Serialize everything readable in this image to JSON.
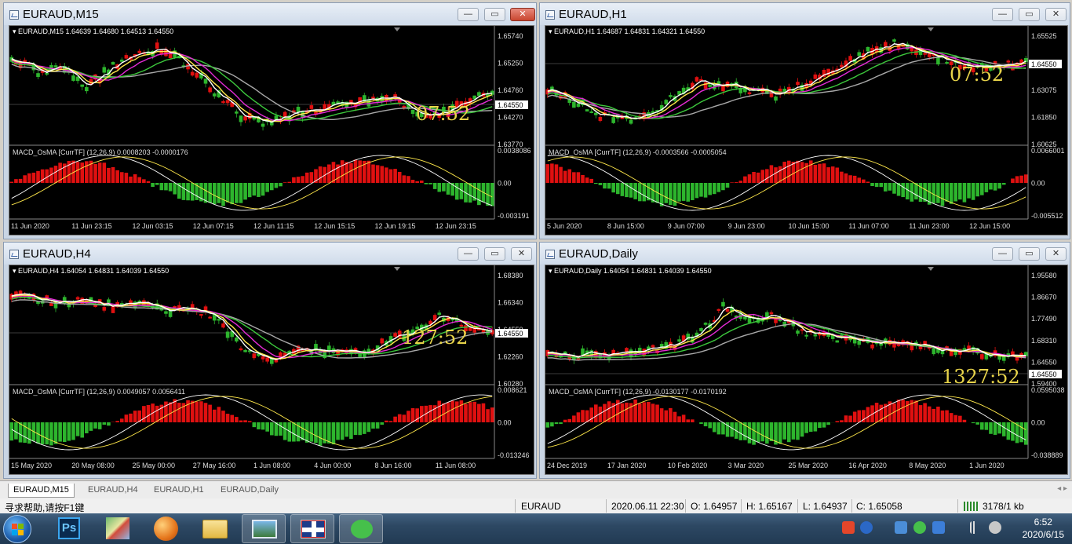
{
  "windows": [
    {
      "title": "EURAUD,M15",
      "info": "EURAUD,M15  1.64639 1.64680 1.64513 1.64550",
      "prices": [
        "1.65740",
        "1.65250",
        "1.64760",
        "1.64270",
        "1.63770"
      ],
      "current_price": "1.64550",
      "timer": "07:52",
      "macd_label": "MACD_OsMA [CurrTF] (12,26,9) 0.0008203 -0.0000176",
      "macd_scale": [
        "0.0038086",
        "0.00",
        "-0.003191"
      ],
      "time_labels": [
        "11 Jun 2020",
        "11 Jun 23:15",
        "12 Jun 03:15",
        "12 Jun 07:15",
        "12 Jun 11:15",
        "12 Jun 15:15",
        "12 Jun 19:15",
        "12 Jun 23:15"
      ]
    },
    {
      "title": "EURAUD,H1",
      "info": "EURAUD,H1  1.64687 1.64831 1.64321 1.64550",
      "prices": [
        "1.65525",
        "1.64550",
        "1.63075",
        "1.61850",
        "1.60625"
      ],
      "current_price": "1.64550",
      "timer": "07:52",
      "macd_label": "MACD_OsMA [CurrTF] (12,26,9) -0.0003566 -0.0005054",
      "macd_scale": [
        "0.0066001",
        "0.00",
        "-0.005512"
      ],
      "time_labels": [
        "5 Jun 2020",
        "8 Jun 15:00",
        "9 Jun 07:00",
        "9 Jun 23:00",
        "10 Jun 15:00",
        "11 Jun 07:00",
        "11 Jun 23:00",
        "12 Jun 15:00"
      ]
    },
    {
      "title": "EURAUD,H4",
      "info": "EURAUD,H4  1.64054 1.64831 1.64039 1.64550",
      "prices": [
        "1.68380",
        "1.66340",
        "1.64550",
        "1.62260",
        "1.60280"
      ],
      "current_price": "1.64550",
      "timer": "127:52",
      "macd_label": "MACD_OsMA [CurrTF] (12,26,9) 0.0049057 0.0056411",
      "macd_scale": [
        "0.008621",
        "0.00",
        "-0.013246"
      ],
      "time_labels": [
        "15 May 2020",
        "20 May 08:00",
        "25 May 00:00",
        "27 May 16:00",
        "1 Jun 08:00",
        "4 Jun 00:00",
        "8 Jun 16:00",
        "11 Jun 08:00"
      ]
    },
    {
      "title": "EURAUD,Daily",
      "info": "EURAUD,Daily  1.64054 1.64831 1.64039 1.64550",
      "prices": [
        "1.95580",
        "1.86670",
        "1.77490",
        "1.68310",
        "1.64550",
        "1.59400"
      ],
      "current_price": "1.64550",
      "timer": "1327:52",
      "macd_label": "MACD_OsMA [CurrTF] (12,26,9) -0.0130177 -0.0170192",
      "macd_scale": [
        "0.0595038",
        "0.00",
        "-0.038889"
      ],
      "time_labels": [
        "24 Dec 2019",
        "17 Jan 2020",
        "10 Feb 2020",
        "3 Mar 2020",
        "25 Mar 2020",
        "16 Apr 2020",
        "8 May 2020",
        "1 Jun 2020"
      ]
    }
  ],
  "tabs": [
    "EURAUD,M15",
    "EURAUD,H4",
    "EURAUD,H1",
    "EURAUD,Daily"
  ],
  "status": {
    "help": "寻求帮助,请按F1键",
    "symbol": "EURAUD",
    "datetime": "2020.06.11 22:30",
    "open": "O: 1.64957",
    "high": "H: 1.65167",
    "low": "L: 1.64937",
    "close": "C: 1.65058",
    "traffic": "3178/1 kb"
  },
  "taskbar": {
    "time": "6:52",
    "date": "2020/6/15",
    "ps_label": "Ps"
  },
  "colors": {
    "chart_bg": "#000000",
    "bull": "#2db52d",
    "bear": "#e01010",
    "ma_white": "#ffffff",
    "ma_yellow": "#ffe84a",
    "ma_magenta": "#e52bd6",
    "ma_green": "#3cc83c",
    "ma_gray": "#a8a8a8",
    "timer": "#e8d44a"
  }
}
